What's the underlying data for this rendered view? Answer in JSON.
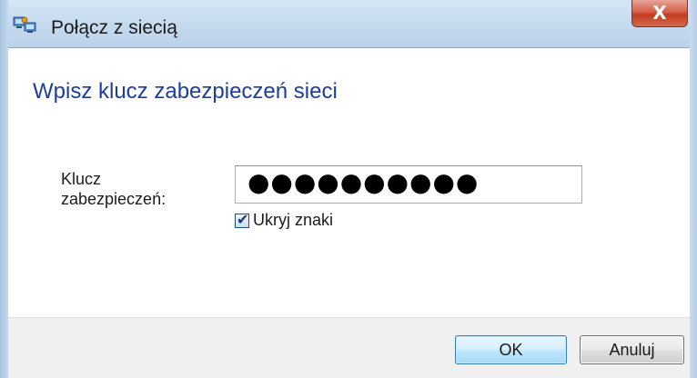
{
  "window": {
    "title": "Połącz z siecią",
    "close_glyph": "X",
    "icon": "network-connect-icon"
  },
  "main": {
    "heading": "Wpisz klucz zabezpieczeń sieci",
    "key_label_line1": "Klucz",
    "key_label_line2": "zabezpieczeń:",
    "password_value": "●●●●●●●●●●",
    "hide_chars_label": "Ukryj znaki",
    "hide_chars_checked": true,
    "checkmark_glyph": "✔"
  },
  "footer": {
    "ok_label": "OK",
    "cancel_label": "Anuluj"
  },
  "colors": {
    "heading": "#1e3d9a",
    "titlebar": "#c3d8ed",
    "close_button": "#c23c21",
    "footer_bg": "#f0f0f0"
  }
}
